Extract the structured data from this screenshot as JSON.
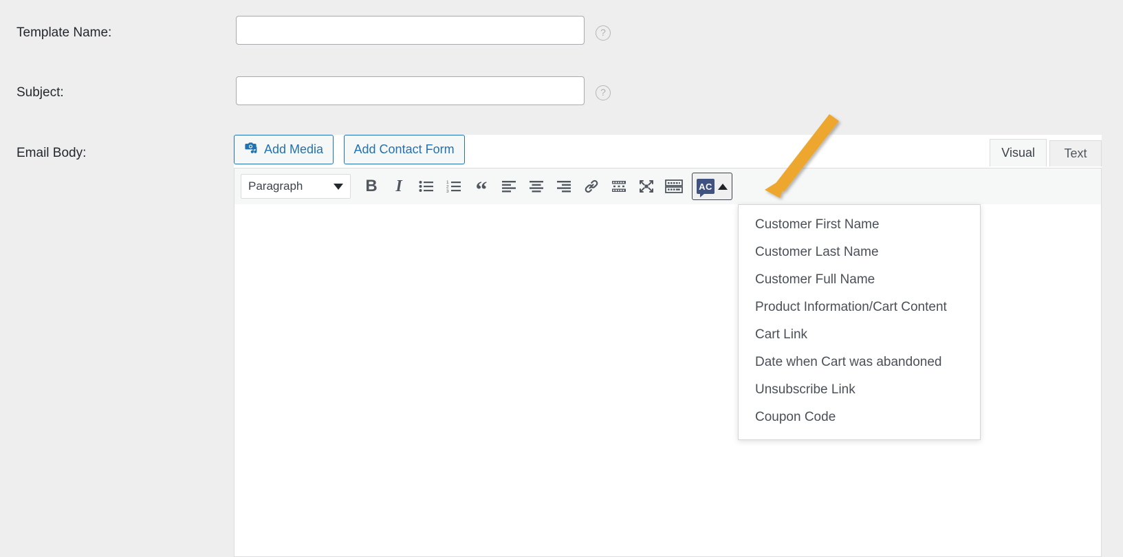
{
  "form": {
    "fields": [
      {
        "label": "Template Name:",
        "value": "",
        "placeholder": "",
        "help": "?"
      },
      {
        "label": "Subject:",
        "value": "",
        "placeholder": "",
        "help": "?"
      }
    ],
    "body_label": "Email Body:"
  },
  "editor": {
    "media_buttons": [
      {
        "label": "Add Media",
        "icon": "camera-music-icon"
      },
      {
        "label": "Add Contact Form",
        "icon": ""
      }
    ],
    "tabs": [
      {
        "label": "Visual",
        "active": true
      },
      {
        "label": "Text",
        "active": false
      }
    ],
    "toolbar": {
      "format_select": {
        "value": "Paragraph",
        "caret": "▼"
      },
      "buttons": [
        {
          "name": "bold",
          "glyph": "B"
        },
        {
          "name": "italic",
          "glyph": "I"
        },
        {
          "name": "bulleted-list",
          "glyph": ""
        },
        {
          "name": "numbered-list",
          "glyph": ""
        },
        {
          "name": "blockquote",
          "glyph": "“"
        },
        {
          "name": "align-left",
          "glyph": ""
        },
        {
          "name": "align-center",
          "glyph": ""
        },
        {
          "name": "align-right",
          "glyph": ""
        },
        {
          "name": "insert-link",
          "glyph": ""
        },
        {
          "name": "read-more",
          "glyph": ""
        },
        {
          "name": "fullscreen",
          "glyph": ""
        },
        {
          "name": "toolbar-toggle",
          "glyph": ""
        }
      ],
      "ac_button": {
        "label": "AC",
        "caret": "▲"
      }
    },
    "content": ""
  },
  "ac_menu": {
    "items": [
      "Customer First Name",
      "Customer Last Name",
      "Customer Full Name",
      "Product Information/Cart Content",
      "Cart Link",
      "Date when Cart was abandoned",
      "Unsubscribe Link",
      "Coupon Code"
    ]
  },
  "annotation": {
    "arrow_color": "#eda62d",
    "target": "ac-button"
  },
  "colors": {
    "page_background": "#eeeeee",
    "accent_blue": "#2271b1",
    "ac_icon_navy": "#3f5280",
    "arrow_orange": "#eda62d",
    "text": "#23282d"
  }
}
